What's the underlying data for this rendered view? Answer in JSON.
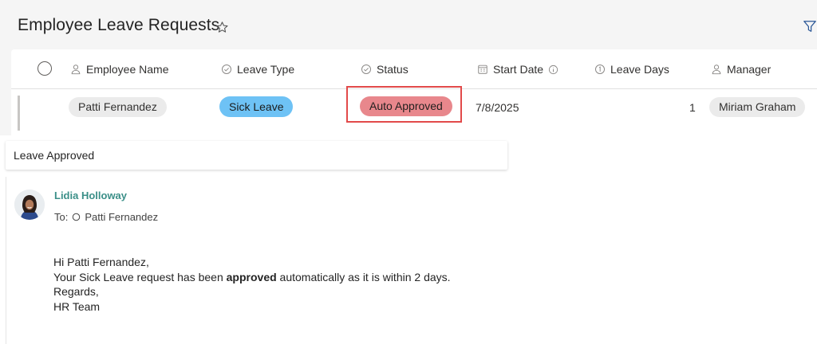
{
  "list": {
    "title": "Employee Leave Requests",
    "columns": [
      {
        "label": "Employee Name",
        "icon": "person-icon"
      },
      {
        "label": "Leave Type",
        "icon": "check-circle-icon"
      },
      {
        "label": "Status",
        "icon": "check-circle-icon"
      },
      {
        "label": "Start Date",
        "icon": "calendar-icon"
      },
      {
        "label": "Leave Days",
        "icon": "number-icon"
      },
      {
        "label": "Manager",
        "icon": "person-icon"
      }
    ],
    "row": {
      "employee": "Patti Fernandez",
      "leave_type": "Sick Leave",
      "status": "Auto Approved",
      "start_date": "7/8/2025",
      "leave_days": "1",
      "manager": "Miriam Graham"
    }
  },
  "colors": {
    "leave_type_pill": "#6ec2f5",
    "status_pill": "#e8878c",
    "highlight_box": "#e24a4a",
    "sender_name": "#3b8f88"
  },
  "email": {
    "subject": "Leave Approved",
    "sender": "Lidia Holloway",
    "to_label": "To:",
    "recipient": "Patti Fernandez",
    "greeting": "Hi Patti Fernandez,",
    "line1_before": "Your Sick Leave request has been",
    "line1_bold": "approved",
    "line1_after": "automatically as it is within 2 days.",
    "closing": "Regards,",
    "signature": "HR Team"
  }
}
